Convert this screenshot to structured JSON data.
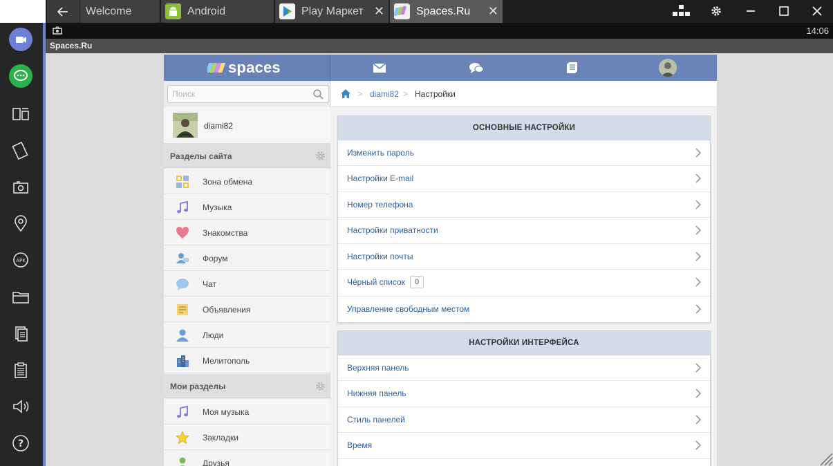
{
  "emulator": {
    "tabs": [
      {
        "label": "Welcome",
        "icon": "none",
        "closable": false,
        "active": false
      },
      {
        "label": "Android",
        "icon": "android-icon",
        "closable": false,
        "active": false
      },
      {
        "label": "Play Маркет",
        "icon": "play-market-icon",
        "closable": true,
        "active": false
      },
      {
        "label": "Spaces.Ru",
        "icon": "spaces-icon",
        "closable": true,
        "active": true
      }
    ],
    "time": "14:06",
    "app_title": "Spaces.Ru",
    "accent_color": "#6f7fd6",
    "sidebar_icons": [
      "video-camera-icon",
      "chat-bubble-icon",
      "multi-window-icon",
      "rotate-icon",
      "camera-icon",
      "location-icon",
      "apk-icon",
      "folder-icon",
      "copy-icon",
      "paste-icon",
      "volume-icon",
      "help-icon"
    ]
  },
  "site": {
    "logo_text": "spaces",
    "header_color": "#6a84b8",
    "search": {
      "placeholder": "Поиск",
      "value": ""
    },
    "user": {
      "name": "diami82"
    },
    "site_sections_title": "Разделы сайта",
    "site_sections": [
      {
        "label": "Зона обмена",
        "icon": "exchange-zone-icon"
      },
      {
        "label": "Музыка",
        "icon": "music-note-icon"
      },
      {
        "label": "Знакомства",
        "icon": "heart-icon"
      },
      {
        "label": "Форум",
        "icon": "forum-icon"
      },
      {
        "label": "Чат",
        "icon": "chat-bubble-icon"
      },
      {
        "label": "Объявления",
        "icon": "announcements-icon"
      },
      {
        "label": "Люди",
        "icon": "person-icon"
      },
      {
        "label": "Мелитополь",
        "icon": "city-icon"
      }
    ],
    "my_sections_title": "Мои разделы",
    "my_sections": [
      {
        "label": "Моя музыка",
        "icon": "music-note-icon"
      },
      {
        "label": "Закладки",
        "icon": "star-icon"
      },
      {
        "label": "Друзья",
        "icon": "friends-icon"
      }
    ],
    "breadcrumb": {
      "user": "diami82",
      "current": "Настройки"
    },
    "panels": [
      {
        "title": "ОСНОВНЫЕ НАСТРОЙКИ",
        "rows": [
          {
            "label": "Изменить пароль"
          },
          {
            "label": "Настройки E-mail"
          },
          {
            "label": "Номер телефона"
          },
          {
            "label": "Настройки приватности"
          },
          {
            "label": "Настройки почты"
          },
          {
            "label": "Чёрный список",
            "badge": "0"
          },
          {
            "label": "Управление свободным местом"
          }
        ]
      },
      {
        "title": "НАСТРОЙКИ ИНТЕРФЕЙСА",
        "rows": [
          {
            "label": "Верхняя панель"
          },
          {
            "label": "Нижняя панель"
          },
          {
            "label": "Стиль панелей"
          },
          {
            "label": "Время"
          }
        ]
      }
    ]
  }
}
